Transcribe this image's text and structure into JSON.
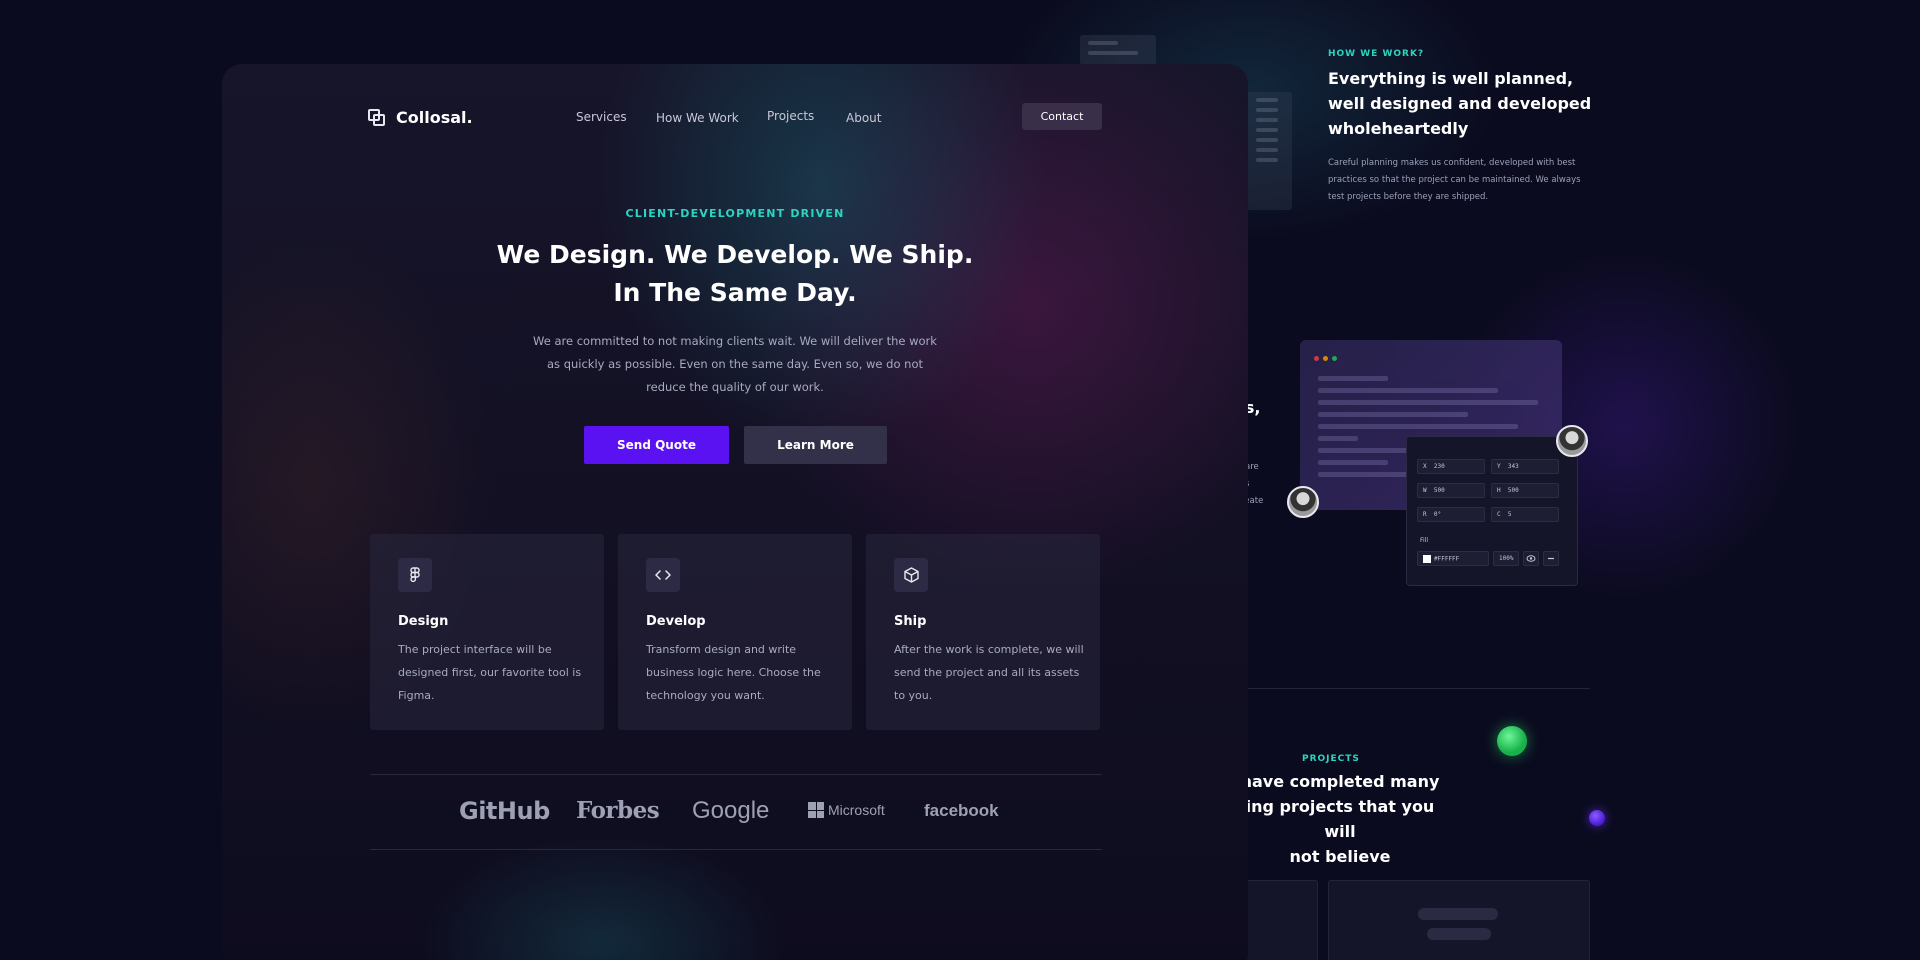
{
  "background_page": {
    "how_we_work": {
      "eyebrow": "HOW WE WORK?",
      "title": "Everything is well planned, well designed and developed wholeheartedly",
      "description": "Careful planning makes us confident, developed with best practices so that the project can be maintained. We always test projects before they are shipped."
    },
    "partial_heading": "rs,",
    "partial_lines": [
      "are",
      "s",
      "reate"
    ],
    "property_panel": {
      "fields": [
        {
          "label": "X",
          "value": "230"
        },
        {
          "label": "Y",
          "value": "343"
        },
        {
          "label": "W",
          "value": "500"
        },
        {
          "label": "H",
          "value": "500"
        },
        {
          "label": "R",
          "value": "0°"
        },
        {
          "label": "C",
          "value": "5"
        }
      ],
      "fill_label": "Fill",
      "fill_value": "#FFFFFF",
      "opacity_value": "100%"
    },
    "projects": {
      "eyebrow": "PROJECTS",
      "title_lines": [
        "have completed many",
        "ing projects that you will",
        "not believe"
      ]
    }
  },
  "navbar": {
    "logo_text": "Collosal.",
    "links": [
      "Services",
      "How We Work",
      "Projects",
      "About"
    ],
    "contact_label": "Contact"
  },
  "hero": {
    "eyebrow": "CLIENT-DEVELOPMENT DRIVEN",
    "title_line_1": "We Design. We Develop. We Ship.",
    "title_line_2": "In The Same Day.",
    "description": "We are committed to not making clients wait. We will deliver the work as quickly as possible. Even on the same day. Even so, we do not reduce the quality of our work.",
    "primary_button": "Send Quote",
    "secondary_button": "Learn More"
  },
  "features": [
    {
      "icon": "figma-icon",
      "title": "Design",
      "description": "The project interface will be designed first, our favorite tool is Figma."
    },
    {
      "icon": "code-icon",
      "title": "Develop",
      "description": "Transform design and write business logic here. Choose the technology you want."
    },
    {
      "icon": "box-icon",
      "title": "Ship",
      "description": "After the work is complete, we will send the project and all its assets to you."
    }
  ],
  "brands": [
    "GitHub",
    "Forbes",
    "Google",
    "Microsoft",
    "facebook"
  ],
  "colors": {
    "accent_primary": "#5b12f2",
    "accent_teal": "#2dd4bf",
    "background": "#0b0b1f",
    "window_dot_red": "#ef4444",
    "window_dot_yellow": "#f59e0b",
    "window_dot_green": "#22c55e"
  }
}
